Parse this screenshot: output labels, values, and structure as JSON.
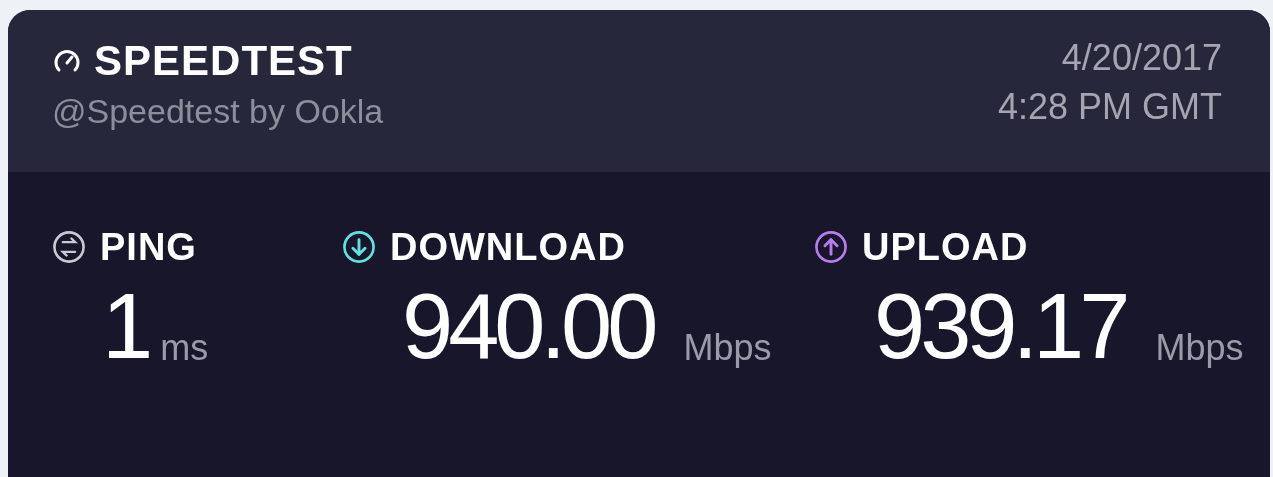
{
  "header": {
    "title": "SPEEDTEST",
    "subtitle": "@Speedtest by Ookla",
    "date": "4/20/2017",
    "time": "4:28 PM GMT"
  },
  "metrics": [
    {
      "kind": "ping",
      "label": "PING",
      "value": "1",
      "unit": "ms"
    },
    {
      "kind": "download",
      "label": "DOWNLOAD",
      "value": "940.00",
      "unit": "Mbps"
    },
    {
      "kind": "upload",
      "label": "UPLOAD",
      "value": "939.17",
      "unit": "Mbps"
    }
  ]
}
